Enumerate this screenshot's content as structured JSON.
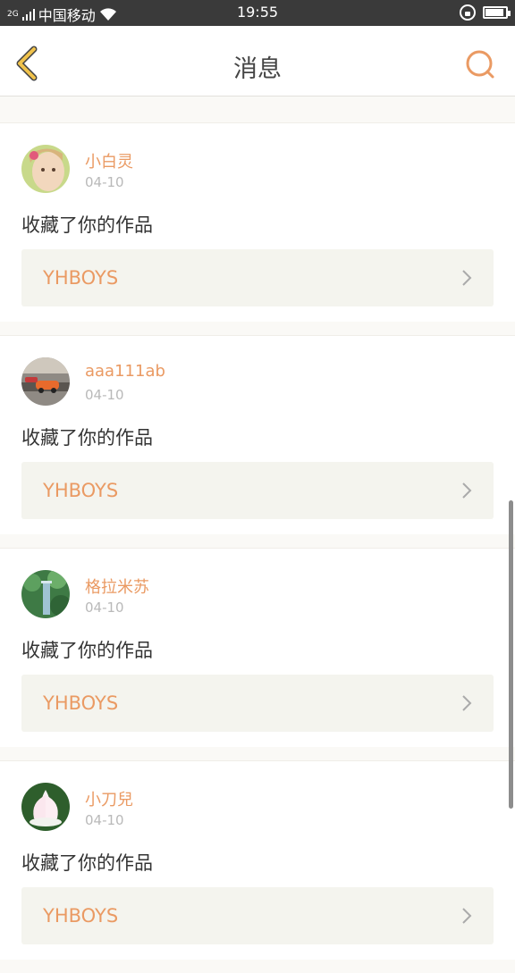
{
  "status_bar": {
    "network": "2G",
    "carrier": "中国移动",
    "time": "19:55"
  },
  "header": {
    "title": "消息",
    "back_icon": "chevron-left-icon",
    "search_icon": "search-icon"
  },
  "colors": {
    "accent": "#ea9a63",
    "back_arrow": "#f0c24b",
    "card_link_bg": "#f4f4ee"
  },
  "messages": [
    {
      "username": "小白灵",
      "date": "04-10",
      "action": "收藏了你的作品",
      "work_title": "YHBOYS"
    },
    {
      "username": "aaa111ab",
      "date": "04-10",
      "action": "收藏了你的作品",
      "work_title": "YHBOYS"
    },
    {
      "username": "格拉米苏",
      "date": "04-10",
      "action": "收藏了你的作品",
      "work_title": "YHBOYS"
    },
    {
      "username": "小刀兒",
      "date": "04-10",
      "action": "收藏了你的作品",
      "work_title": "YHBOYS"
    }
  ]
}
